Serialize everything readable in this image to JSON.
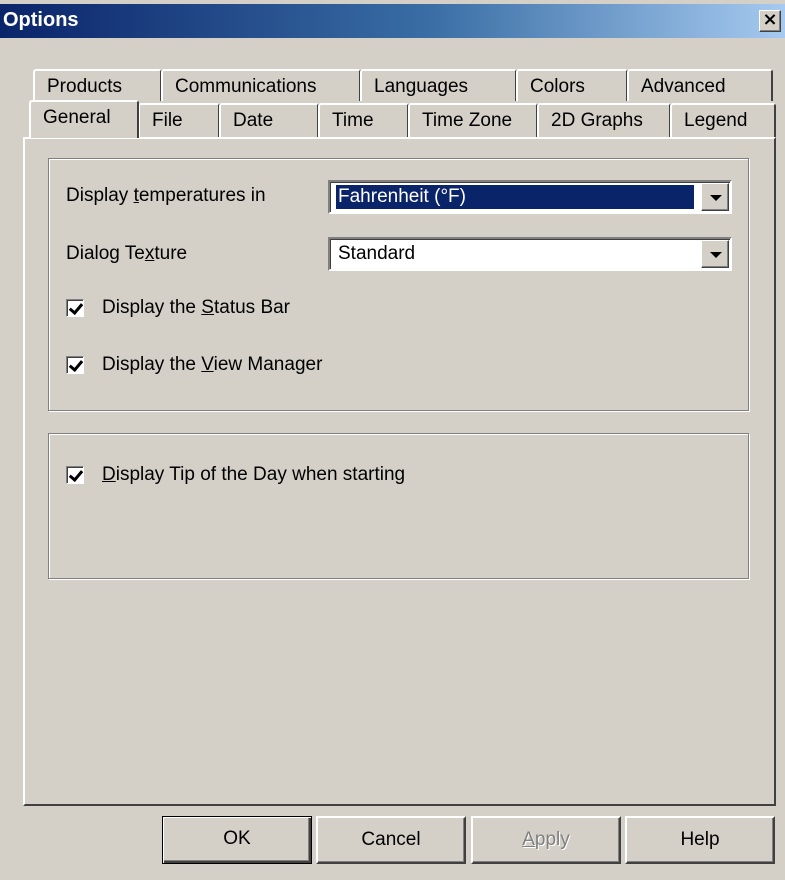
{
  "window": {
    "title": "Options",
    "close_label": "×"
  },
  "tabs": {
    "back_row": [
      "Products",
      "Communications",
      "Languages",
      "Colors",
      "Advanced"
    ],
    "front_row": [
      "General",
      "File",
      "Date",
      "Time",
      "Time Zone",
      "2D Graphs",
      "Legend"
    ],
    "selected": "General"
  },
  "general": {
    "temperature_label_pre": "Display ",
    "temperature_label_key": "t",
    "temperature_label_post": "emperatures in",
    "temperature_value": "Fahrenheit (°F)",
    "texture_label_pre": "Dialog Te",
    "texture_label_key": "x",
    "texture_label_post": "ture",
    "texture_value": "Standard",
    "status_bar": {
      "pre": "Display the ",
      "key": "S",
      "post": "tatus Bar",
      "checked": true
    },
    "view_manager": {
      "pre": "Display the ",
      "key": "V",
      "post": "iew Manager",
      "checked": true
    },
    "tip_of_day": {
      "pre": "",
      "key": "D",
      "post": "isplay Tip of the Day when starting",
      "checked": true
    }
  },
  "buttons": {
    "ok": "OK",
    "cancel": "Cancel",
    "apply_key": "A",
    "apply_rest": "pply",
    "help": "Help"
  }
}
